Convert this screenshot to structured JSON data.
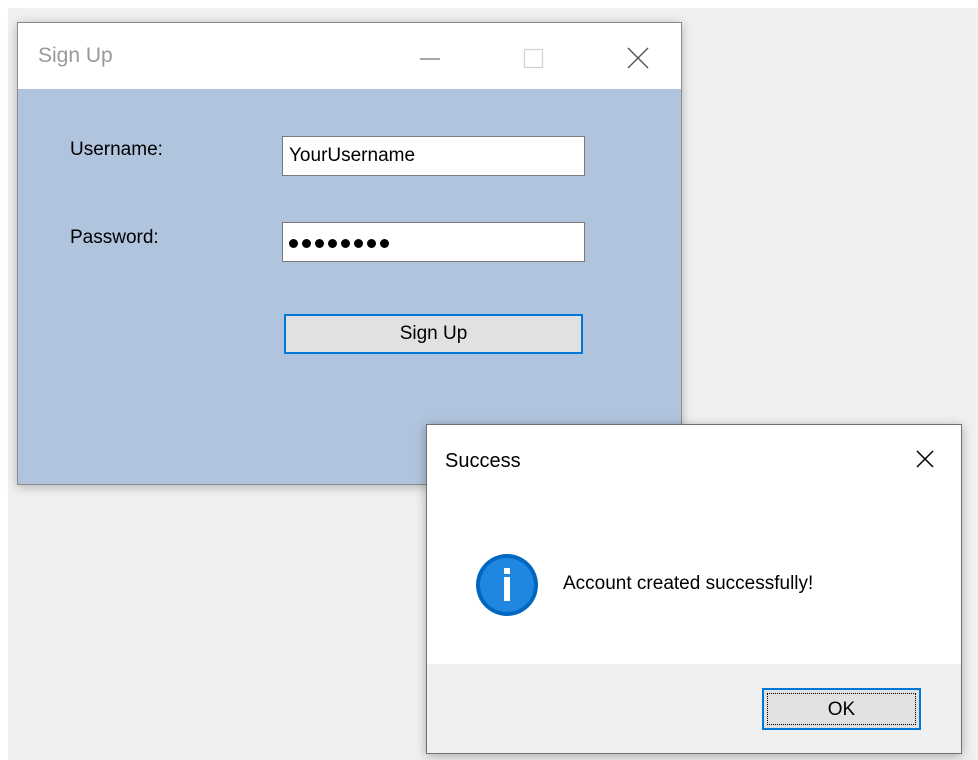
{
  "signup_window": {
    "title": "Sign Up",
    "background_color": "#b0c4de",
    "controls": {
      "minimize_icon": "minimize-icon",
      "maximize_icon": "maximize-icon",
      "close_icon": "close-icon"
    },
    "form": {
      "username_label": "Username:",
      "username_value": "YourUsername",
      "password_label": "Password:",
      "password_masked_count": 8,
      "submit_label": "Sign Up"
    }
  },
  "success_dialog": {
    "title": "Success",
    "icon": "info-icon",
    "icon_color": "#0067c0",
    "message": "Account created successfully!",
    "ok_label": "OK",
    "close_icon": "close-icon"
  },
  "accent_color": "#0078d7"
}
